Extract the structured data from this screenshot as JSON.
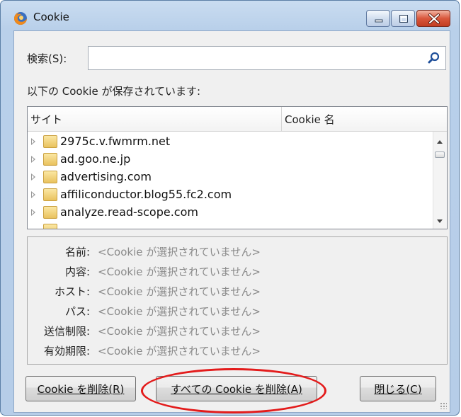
{
  "window": {
    "title": "Cookie",
    "icons": {
      "app": "firefox-icon",
      "minimize": "minimize-icon",
      "maximize": "maximize-icon",
      "close": "close-icon"
    }
  },
  "search": {
    "label": "検索(S):",
    "value": "",
    "placeholder": "",
    "icon": "search-icon"
  },
  "list_caption": "以下の Cookie が保存されています:",
  "table": {
    "columns": [
      "サイト",
      "Cookie 名"
    ],
    "rows": [
      {
        "site": "2975c.v.fwmrm.net",
        "cookie": ""
      },
      {
        "site": "ad.goo.ne.jp",
        "cookie": ""
      },
      {
        "site": "advertising.com",
        "cookie": ""
      },
      {
        "site": "affiliconductor.blog55.fc2.com",
        "cookie": ""
      },
      {
        "site": "analyze.read-scope.com",
        "cookie": ""
      }
    ]
  },
  "details": [
    {
      "key": "名前:",
      "value": "<Cookie が選択されていません>"
    },
    {
      "key": "内容:",
      "value": "<Cookie が選択されていません>"
    },
    {
      "key": "ホスト:",
      "value": "<Cookie が選択されていません>"
    },
    {
      "key": "パス:",
      "value": "<Cookie が選択されていません>"
    },
    {
      "key": "送信制限:",
      "value": "<Cookie が選択されていません>"
    },
    {
      "key": "有効期限:",
      "value": "<Cookie が選択されていません>"
    }
  ],
  "buttons": {
    "delete": "Cookie を削除(R)",
    "delete_all": "すべての Cookie を削除(A)",
    "close": "閉じる(C)"
  },
  "colors": {
    "highlight_ellipse": "#e31b1b",
    "titlebar": "#b9d0ea",
    "folder": "#e9c25e"
  }
}
